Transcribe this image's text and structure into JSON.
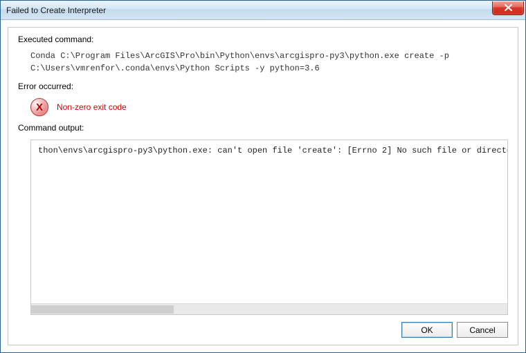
{
  "window": {
    "title": "Failed to Create Interpreter"
  },
  "sections": {
    "executed_label": "Executed command:",
    "executed_command": "Conda C:\\Program Files\\ArcGIS\\Pro\\bin\\Python\\envs\\arcgispro-py3\\python.exe create -p\nC:\\Users\\vmrenfor\\.conda\\envs\\Python Scripts -y python=3.6",
    "error_label": "Error occurred:",
    "error_message": "Non-zero exit code",
    "output_label": "Command output:",
    "output_text": "thon\\envs\\arcgispro-py3\\python.exe: can't open file 'create': [Errno 2] No such file or directory"
  },
  "buttons": {
    "ok": "OK",
    "cancel": "Cancel"
  },
  "icons": {
    "error_x": "X"
  }
}
